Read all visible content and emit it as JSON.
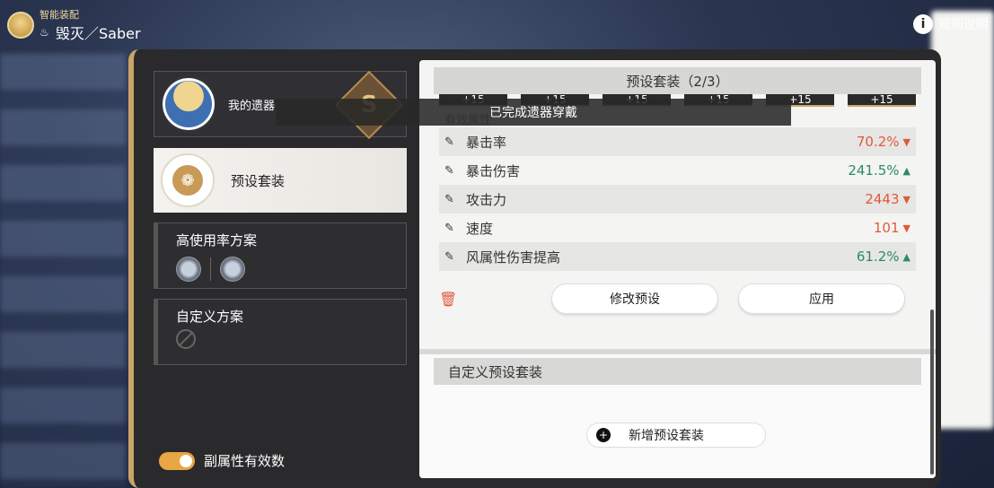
{
  "top": {
    "subtitle": "智能装配",
    "title": "毁灭／Saber",
    "path_icon": "destruction-path-icon",
    "rules_label": "规则说明"
  },
  "left": {
    "relic_label": "我的遗器",
    "preset_label": "预设套装",
    "high_use_title": "高使用率方案",
    "custom_plan_title": "自定义方案",
    "toggle_label": "副属性有效数",
    "toggle_on": true
  },
  "right": {
    "header": "预设套装（2/3）",
    "boosts": [
      "+15",
      "+15",
      "+15",
      "+15",
      "+15",
      "+15"
    ],
    "section_label": "有效属性",
    "attributes": [
      {
        "icon": "crit-rate-icon",
        "name": "暴击率",
        "value": "70.2%",
        "trend": "down"
      },
      {
        "icon": "crit-dmg-icon",
        "name": "暴击伤害",
        "value": "241.5%",
        "trend": "up"
      },
      {
        "icon": "atk-icon",
        "name": "攻击力",
        "value": "2443",
        "trend": "down"
      },
      {
        "icon": "speed-icon",
        "name": "速度",
        "value": "101",
        "trend": "down"
      },
      {
        "icon": "wind-dmg-icon",
        "name": "风属性伤害提高",
        "value": "61.2%",
        "trend": "up"
      }
    ],
    "edit_button": "修改预设",
    "apply_button": "应用",
    "custom_header": "自定义预设套装",
    "add_button": "新增预设套装"
  },
  "toast": "已完成遗器穿戴",
  "colors": {
    "down": "#e05a3c",
    "up": "#2d8a68",
    "accent": "#e8a645"
  }
}
